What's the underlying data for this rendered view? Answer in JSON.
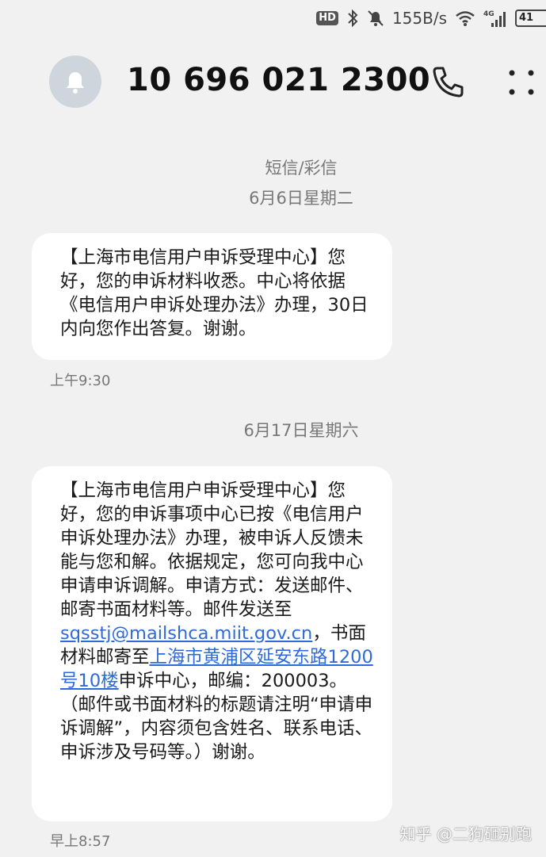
{
  "status_bar": {
    "hd": "HD",
    "net_speed": "155B/s",
    "network": "4G",
    "battery": "41"
  },
  "header": {
    "contact": "10 696 021 2300"
  },
  "thread": {
    "type_label": "短信/彩信",
    "date1": "6月6日星期二",
    "msg1_text": "【上海市电信用户申诉受理中心】您好，您的申诉材料收悉。中心将依据《电信用户申诉处理办法》办理，30日内向您作出答复。谢谢。",
    "time1": "上午9:30",
    "date2": "6月17日星期六",
    "msg2_part1": "【上海市电信用户申诉受理中心】您好，您的申诉事项中心已按《电信用户申诉处理办法》办理，被申诉人反馈未能与您和解。依据规定，您可向我中心申请申诉调解。申请方式：发送邮件、邮寄书面材料等。邮件发送至 ",
    "msg2_email": "sqsstj@mailshca.miit.gov.cn",
    "msg2_part2": "，书面材料邮寄至",
    "msg2_address": "上海市黄浦区延安东路1200号10楼",
    "msg2_part3": "申诉中心，邮编：200003。（邮件或书面材料的标题请注明“申请申诉调解”，内容须包含姓名、联系电话、申诉涉及号码等。）谢谢。",
    "time2": "早上8:57"
  },
  "watermark": "知乎 @二狗砸别跑"
}
